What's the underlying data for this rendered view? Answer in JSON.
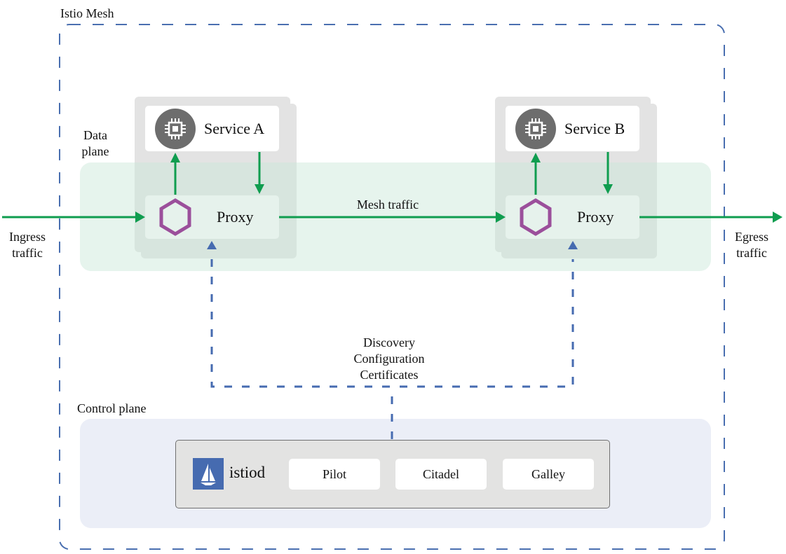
{
  "mesh": {
    "title": "Istio Mesh"
  },
  "data_plane": {
    "label_line1": "Data",
    "label_line2": "plane"
  },
  "control_plane": {
    "label": "Control plane"
  },
  "services": [
    {
      "name": "Service A",
      "icon": "cpu-chip-icon",
      "proxy": {
        "label": "Proxy",
        "icon": "hexagon-icon"
      }
    },
    {
      "name": "Service B",
      "icon": "cpu-chip-icon",
      "proxy": {
        "label": "Proxy",
        "icon": "hexagon-icon"
      }
    }
  ],
  "traffic": {
    "ingress_line1": "Ingress",
    "ingress_line2": "traffic",
    "egress_line1": "Egress",
    "egress_line2": "traffic",
    "mesh": "Mesh traffic"
  },
  "control_flow": {
    "lines": [
      "Discovery",
      "Configuration",
      "Certificates"
    ]
  },
  "istiod": {
    "name": "istiod",
    "logo_icon": "sailboat-icon",
    "components": [
      "Pilot",
      "Citadel",
      "Galley"
    ]
  },
  "colors": {
    "mesh_border": "#4a6fb0",
    "traffic_arrow": "#0f9d4f",
    "control_arrow": "#466bb0",
    "proxy_hexagon": "#9b4f9b",
    "service_icon_bg": "#6d6d6d",
    "istiod_logo_bg": "#466bb0"
  }
}
